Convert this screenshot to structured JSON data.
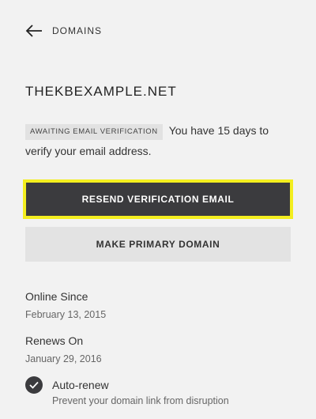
{
  "nav": {
    "back_label": "DOMAINS",
    "back_icon": "arrow-left-icon"
  },
  "domain": {
    "name": "THEKBEXAMPLE.NET"
  },
  "status": {
    "badge": "AWAITING EMAIL VERIFICATION",
    "message": "You have 15 days to verify your email address."
  },
  "actions": {
    "resend_label": "RESEND VERIFICATION EMAIL",
    "primary_label": "MAKE PRIMARY DOMAIN"
  },
  "details": {
    "online_since_label": "Online Since",
    "online_since_value": "February 13, 2015",
    "renews_on_label": "Renews On",
    "renews_on_value": "January 29, 2016"
  },
  "autorenew": {
    "label": "Auto-renew",
    "description": "Prevent your domain link from disruption",
    "checked": true,
    "icon": "check-icon"
  },
  "colors": {
    "background": "#f2f2f2",
    "primary_button": "#3b3b3e",
    "highlight": "#f3ee1f",
    "secondary_button": "#e3e3e3"
  }
}
